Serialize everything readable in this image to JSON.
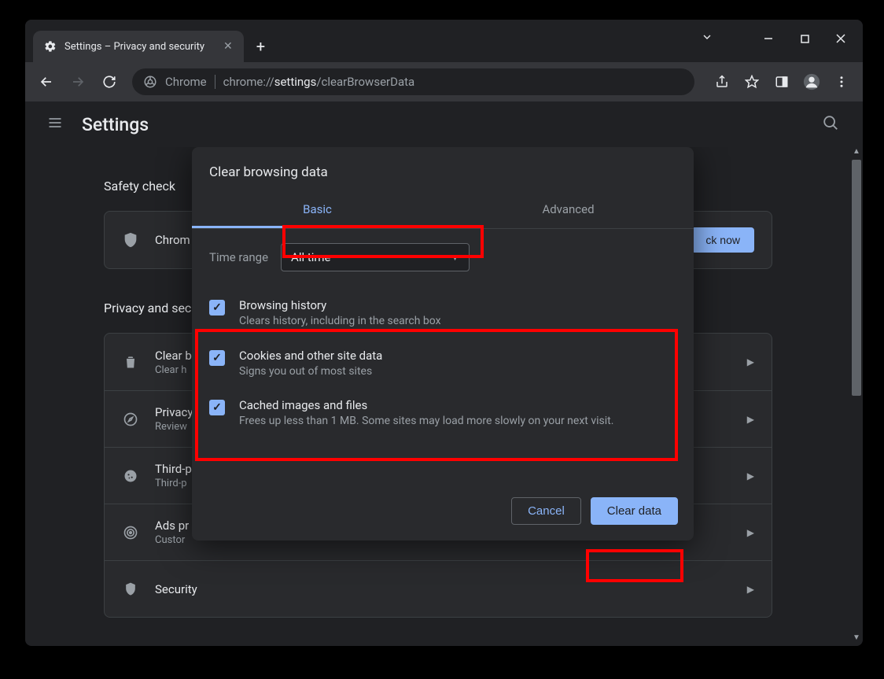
{
  "tab": {
    "title": "Settings – Privacy and security"
  },
  "omnibox": {
    "prefix": "Chrome",
    "url_pre": "chrome://",
    "url_bold": "settings",
    "url_post": "/clearBrowserData"
  },
  "app": {
    "title": "Settings"
  },
  "bg": {
    "safety_title": "Safety check",
    "safety_text": "Chrom",
    "check_now": "ck now",
    "privacy_title": "Privacy and sec",
    "rows": [
      {
        "t": "Clear b",
        "s": "Clear h"
      },
      {
        "t": "Privacy",
        "s": "Review"
      },
      {
        "t": "Third-p",
        "s": "Third-p"
      },
      {
        "t": "Ads pr",
        "s": "Custor"
      },
      {
        "t": "Security",
        "s": ""
      }
    ]
  },
  "dialog": {
    "title": "Clear browsing data",
    "tabs": {
      "basic": "Basic",
      "advanced": "Advanced"
    },
    "time_label": "Time range",
    "time_value": "All time",
    "items": [
      {
        "t": "Browsing history",
        "s": "Clears history, including in the search box"
      },
      {
        "t": "Cookies and other site data",
        "s": "Signs you out of most sites"
      },
      {
        "t": "Cached images and files",
        "s": "Frees up less than 1 MB. Some sites may load more slowly on your next visit."
      }
    ],
    "cancel": "Cancel",
    "confirm": "Clear data"
  }
}
